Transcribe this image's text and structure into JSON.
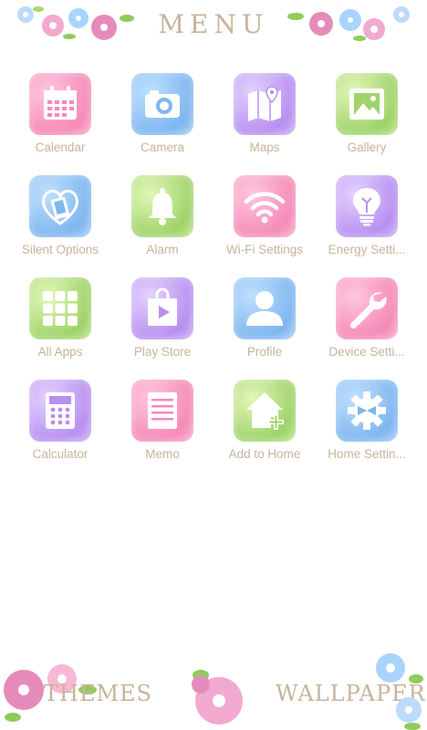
{
  "header": {
    "title": "MENU"
  },
  "apps": [
    {
      "label": "Calendar",
      "icon": "calendar-icon",
      "color": "pink"
    },
    {
      "label": "Camera",
      "icon": "camera-icon",
      "color": "blue"
    },
    {
      "label": "Maps",
      "icon": "map-icon",
      "color": "purple"
    },
    {
      "label": "Gallery",
      "icon": "gallery-icon",
      "color": "green"
    },
    {
      "label": "Silent Options",
      "icon": "silent-heart-phone-icon",
      "color": "blue"
    },
    {
      "label": "Alarm",
      "icon": "bell-icon",
      "color": "green"
    },
    {
      "label": "Wi-Fi Settings",
      "icon": "wifi-icon",
      "color": "pink"
    },
    {
      "label": "Energy Setti...",
      "icon": "lightbulb-icon",
      "color": "purple"
    },
    {
      "label": "All Apps",
      "icon": "grid-icon",
      "color": "green"
    },
    {
      "label": "Play Store",
      "icon": "play-store-icon",
      "color": "purple"
    },
    {
      "label": "Profile",
      "icon": "person-icon",
      "color": "blue"
    },
    {
      "label": "Device Setti...",
      "icon": "wrench-icon",
      "color": "pink"
    },
    {
      "label": "Calculator",
      "icon": "calculator-icon",
      "color": "purple"
    },
    {
      "label": "Memo",
      "icon": "memo-icon",
      "color": "pink"
    },
    {
      "label": "Add to Home",
      "icon": "add-home-icon",
      "color": "green"
    },
    {
      "label": "Home Settin...",
      "icon": "gear-icon",
      "color": "blue"
    }
  ],
  "bottom": {
    "themes_label": "THEMES",
    "wallpapers_label": "WALLPAPERS"
  }
}
